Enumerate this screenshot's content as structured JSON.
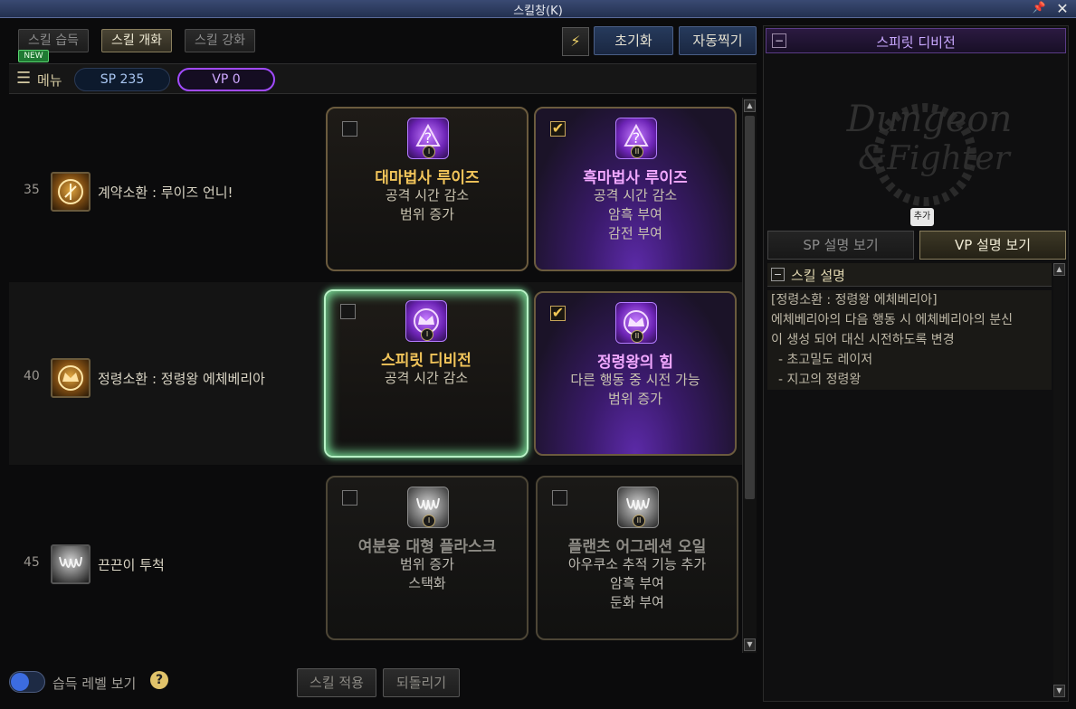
{
  "window": {
    "title": "스킬창(K)"
  },
  "tabs": [
    {
      "label": "스킬 습득",
      "active": false
    },
    {
      "label": "스킬 개화",
      "active": true
    },
    {
      "label": "스킬 강화",
      "active": false
    }
  ],
  "new_badge": "NEW",
  "toolbar": {
    "reset_label": "초기화",
    "auto_label": "자동찍기",
    "icon": "lightning-icon"
  },
  "menu": {
    "label": "메뉴",
    "sp": "SP 235",
    "vp": "VP 0"
  },
  "rows": [
    {
      "level": "35",
      "skill_name": "계약소환 : 루이즈 언니!",
      "icon": "contract-summon-icon",
      "cards": [
        {
          "title": "대마법사 루이즈",
          "lines": [
            "공격 시간 감소",
            "범위 증가"
          ],
          "checked": false,
          "tier": "I"
        },
        {
          "title": "흑마법사 루이즈",
          "lines": [
            "공격 시간 감소",
            "암흑 부여",
            "감전 부여"
          ],
          "checked": true,
          "tier": "II"
        }
      ]
    },
    {
      "level": "40",
      "skill_name": "정령소환 : 정령왕 에체베리아",
      "icon": "spirit-king-icon",
      "cards": [
        {
          "title": "스피릿 디비전",
          "lines": [
            "공격 시간 감소"
          ],
          "checked": false,
          "tier": "I"
        },
        {
          "title": "정령왕의 힘",
          "lines": [
            "다른 행동 중 시전 가능",
            "범위 증가"
          ],
          "checked": true,
          "tier": "II"
        }
      ]
    },
    {
      "level": "45",
      "skill_name": "끈끈이 투척",
      "icon": "sticky-throw-icon",
      "cards": [
        {
          "title": "여분용 대형 플라스크",
          "lines": [
            "범위 증가",
            "스택화"
          ],
          "checked": false,
          "tier": "I"
        },
        {
          "title": "플랜츠 어그레션 오일",
          "lines": [
            "아우쿠소 추적 기능 추가",
            "암흑 부여",
            "둔화 부여"
          ],
          "checked": false,
          "tier": "II"
        }
      ]
    }
  ],
  "footer": {
    "toggle_label": "습득 레벨 보기",
    "apply_label": "스킬 적용",
    "revert_label": "되돌리기",
    "help": "?"
  },
  "right_panel": {
    "title": "스피릿 디비전",
    "add_label": "추가",
    "sp_tab": "SP 설명 보기",
    "vp_tab": "VP 설명 보기",
    "desc_header": "스킬 설명",
    "desc_lines": [
      "[정령소환 : 정령왕 에체베리아]",
      "에체베리아의 다음 행동 시 에체베리아의 분신",
      "이 생성 되어 대신 시전하도록 변경",
      " - 초고밀도 레이저",
      " - 지고의 정령왕"
    ]
  },
  "colors": {
    "accent_gold": "#f1c45a",
    "accent_violet": "#a24bff",
    "glow_green": "#7be39a"
  }
}
